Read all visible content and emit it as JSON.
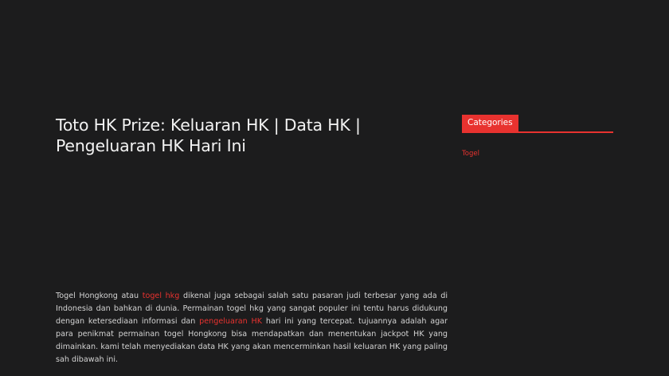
{
  "post": {
    "title": "Toto HK Prize: Keluaran HK | Data HK | Pengeluaran HK Hari Ini",
    "body": {
      "p1": "Togel Hongkong atau ",
      "link1": "togel hkg",
      "p2": " dikenal juga sebagai salah satu pasaran judi terbesar yang ada di Indonesia dan bahkan di dunia. Permainan togel hkg yang sangat populer ini tentu harus didukung dengan ketersediaan informasi dan ",
      "link2": "pengeluaran HK",
      "p3": " hari ini yang tercepat. tujuannya adalah agar para penikmat permainan togel Hongkong bisa mendapatkan dan menentukan jackpot HK yang dimainkan. kami telah menyediakan data HK yang akan mencerminkan hasil keluaran HK yang paling sah dibawah ini."
    }
  },
  "sidebar": {
    "widget_title": "Categories",
    "categories": [
      "Togel"
    ]
  },
  "colors": {
    "background": "#1c1c1d",
    "accent": "#e8322f",
    "text": "#e6e6e6"
  }
}
